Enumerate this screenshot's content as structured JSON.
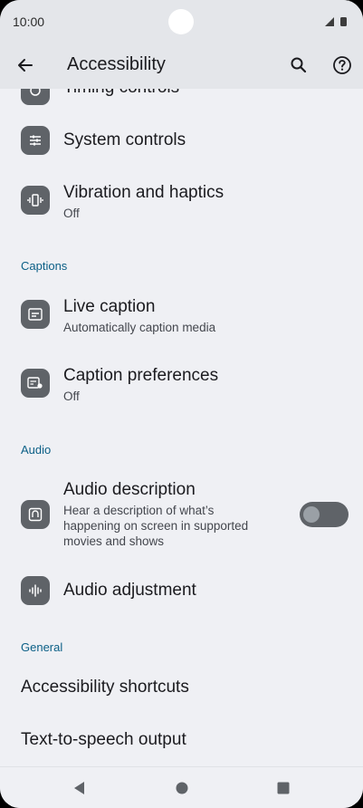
{
  "status_bar": {
    "time": "10:00"
  },
  "app_bar": {
    "title": "Accessibility"
  },
  "items": {
    "timing": {
      "title": "Timing controls"
    },
    "system": {
      "title": "System controls"
    },
    "vibration": {
      "title": "Vibration and haptics",
      "subtitle": "Off"
    },
    "captions_header": "Captions",
    "live_caption": {
      "title": "Live caption",
      "subtitle": "Automatically caption media"
    },
    "caption_prefs": {
      "title": "Caption preferences",
      "subtitle": "Off"
    },
    "audio_header": "Audio",
    "audio_description": {
      "title": "Audio description",
      "subtitle_line1": "Hear a description of what’s",
      "subtitle_line2": "happening on screen in supported",
      "subtitle_line3": "movies and shows",
      "toggle_on": false
    },
    "audio_adjustment": {
      "title": "Audio adjustment"
    },
    "general_header": "General",
    "accessibility_shortcuts": {
      "title": "Accessibility shortcuts"
    },
    "tts": {
      "title": "Text-to-speech output"
    }
  },
  "colors": {
    "accent": "#0b5f86",
    "icon_tile": "#5f6368",
    "background": "#eff0f4",
    "app_bar": "#e4e6ea"
  }
}
